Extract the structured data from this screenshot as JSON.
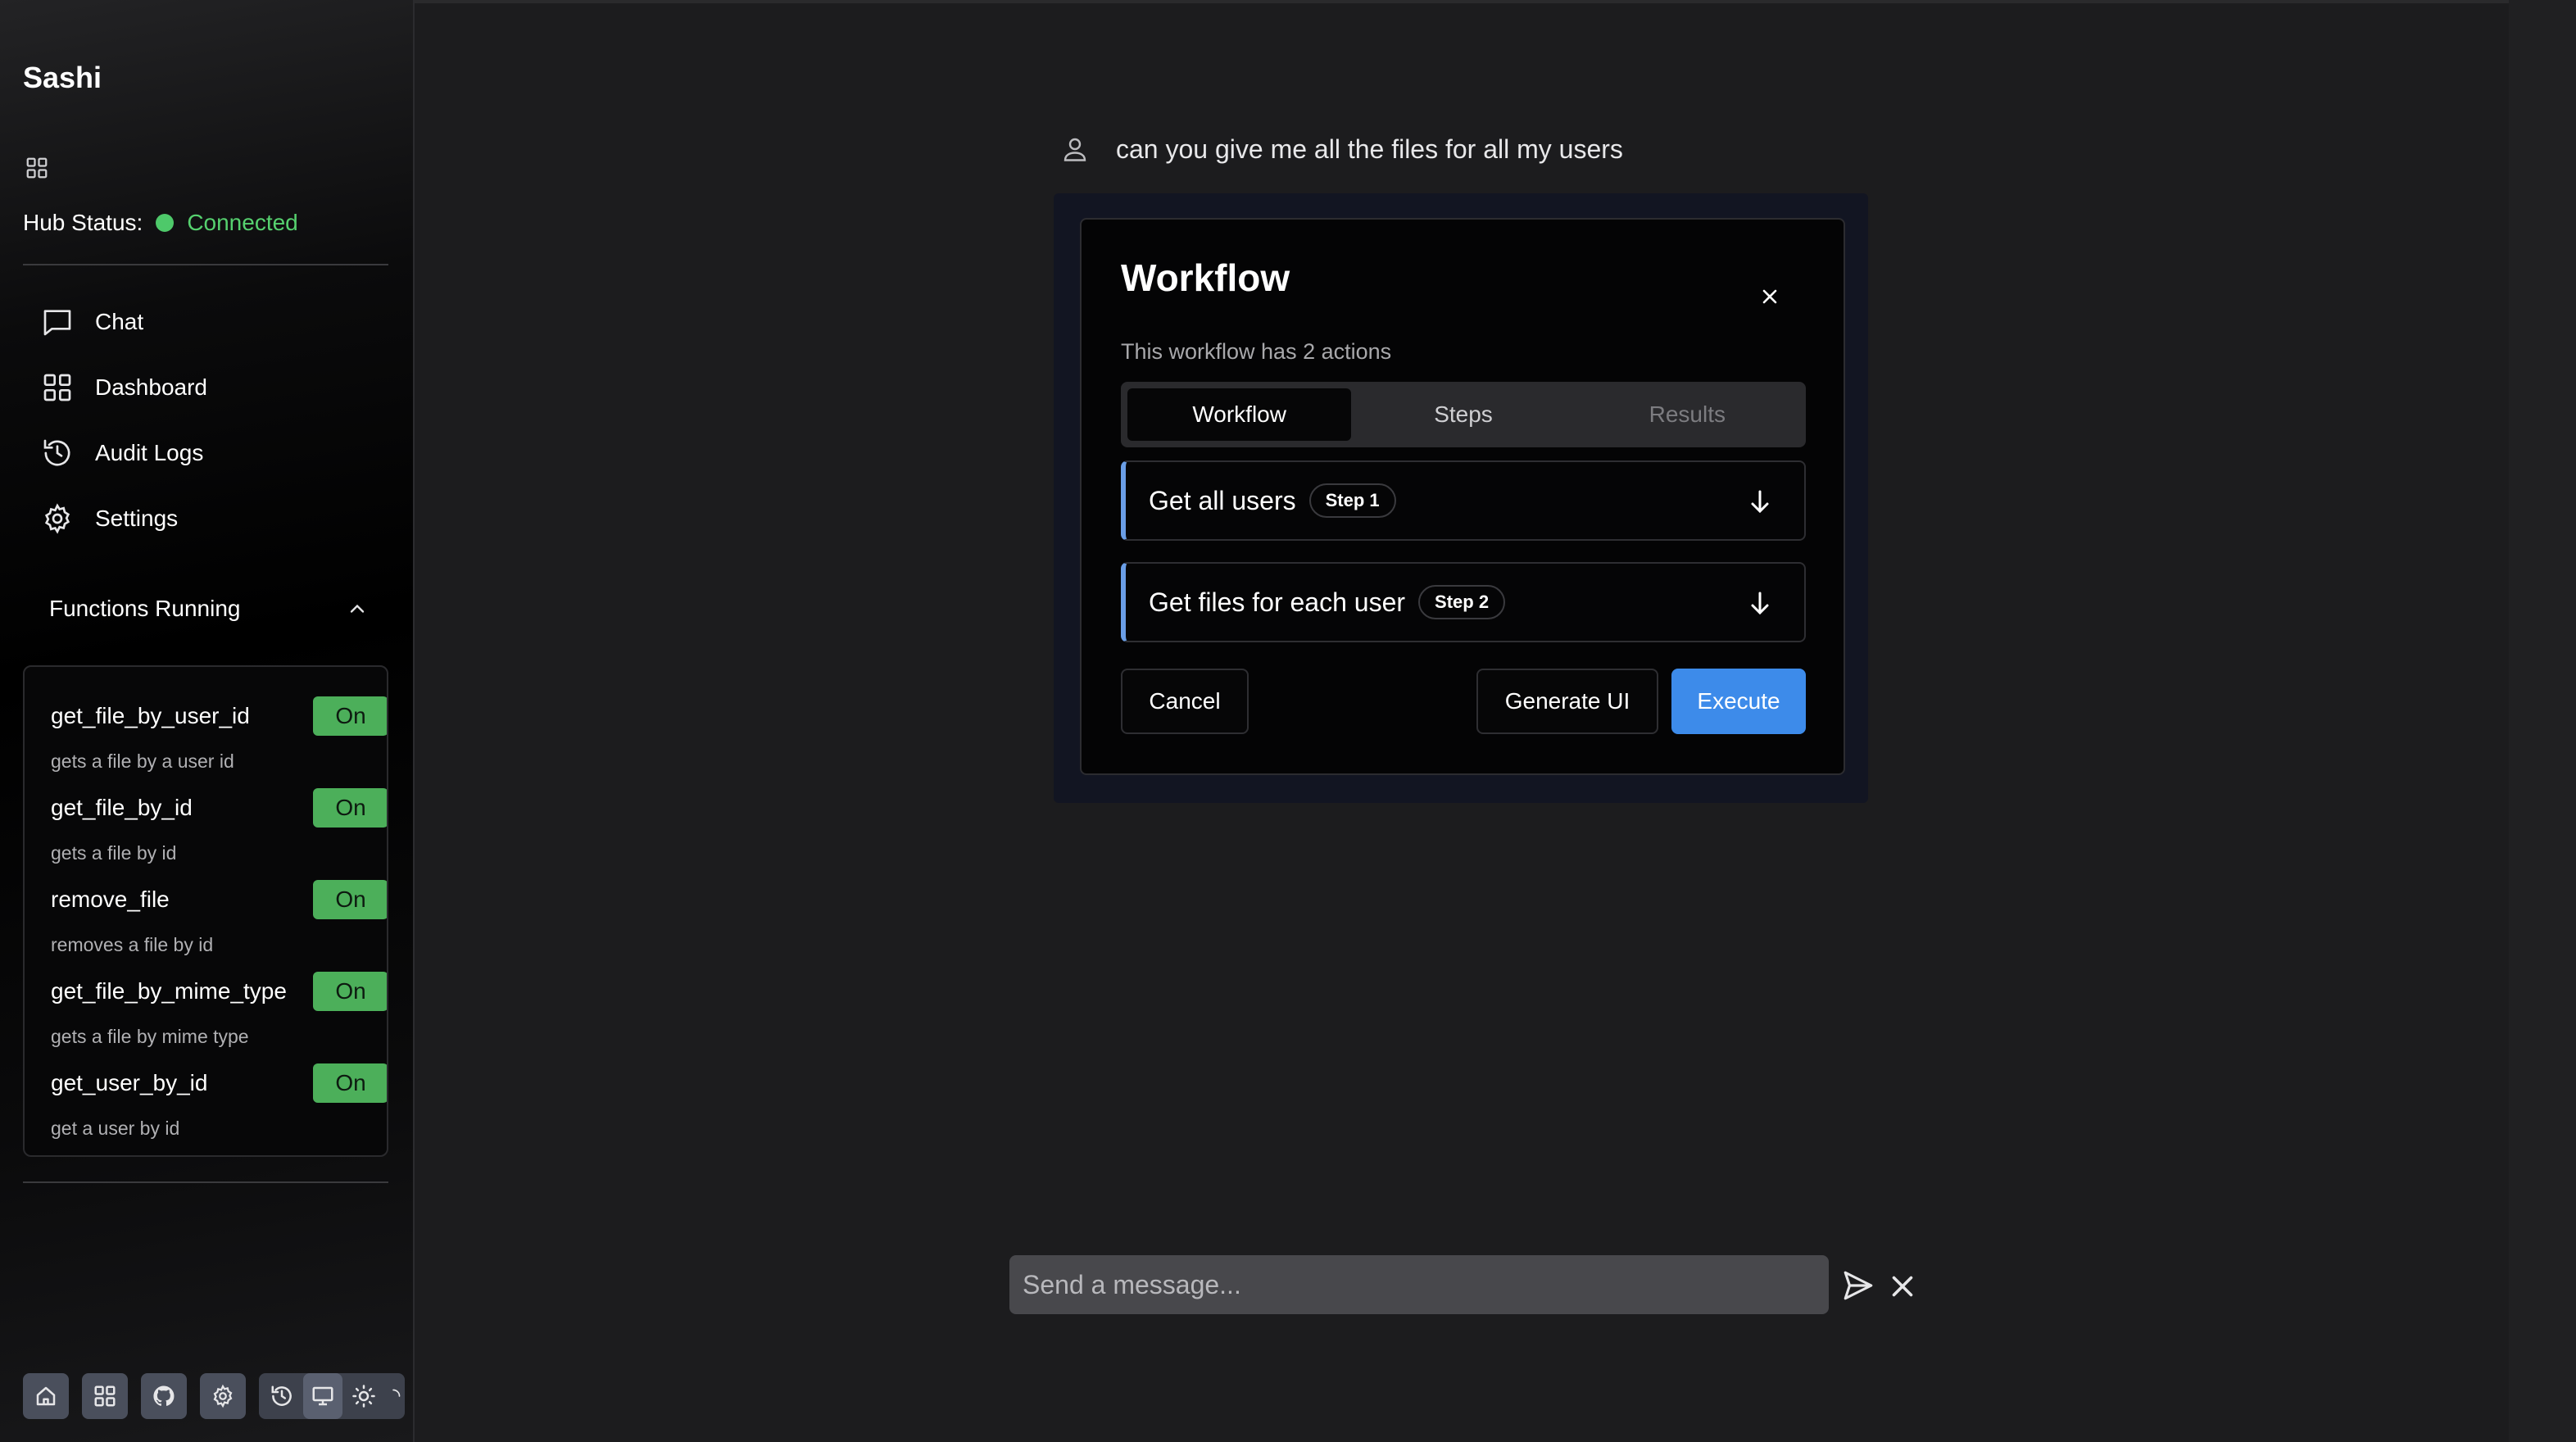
{
  "app": {
    "title": "Sashi"
  },
  "hub": {
    "label": "Hub Status:",
    "status": "Connected",
    "status_color": "#56d16f"
  },
  "nav": [
    {
      "label": "Chat",
      "icon": "chat-icon"
    },
    {
      "label": "Dashboard",
      "icon": "dashboard-icon"
    },
    {
      "label": "Audit Logs",
      "icon": "history-icon"
    },
    {
      "label": "Settings",
      "icon": "gear-icon"
    }
  ],
  "functions": {
    "header": "Functions Running",
    "items": [
      {
        "name": "get_file_by_user_id",
        "status": "On",
        "desc": "gets a file by a user id"
      },
      {
        "name": "get_file_by_id",
        "status": "On",
        "desc": "gets a file by id"
      },
      {
        "name": "remove_file",
        "status": "On",
        "desc": "removes a file by id"
      },
      {
        "name": "get_file_by_mime_type",
        "status": "On",
        "desc": "gets a file by mime type"
      },
      {
        "name": "get_user_by_id",
        "status": "On",
        "desc": "get a user by id"
      }
    ]
  },
  "chat": {
    "user_message": "can you give me all the files for all my users",
    "input_placeholder": "Send a message..."
  },
  "workflow": {
    "title": "Workflow",
    "subtitle": "This workflow has 2 actions",
    "tabs": [
      "Workflow",
      "Steps",
      "Results"
    ],
    "steps": [
      {
        "title": "Get all users",
        "badge": "Step 1"
      },
      {
        "title": "Get files for each user",
        "badge": "Step 2"
      }
    ],
    "buttons": {
      "cancel": "Cancel",
      "generate": "Generate UI",
      "execute": "Execute"
    },
    "accent_color": "#3d8bea"
  }
}
